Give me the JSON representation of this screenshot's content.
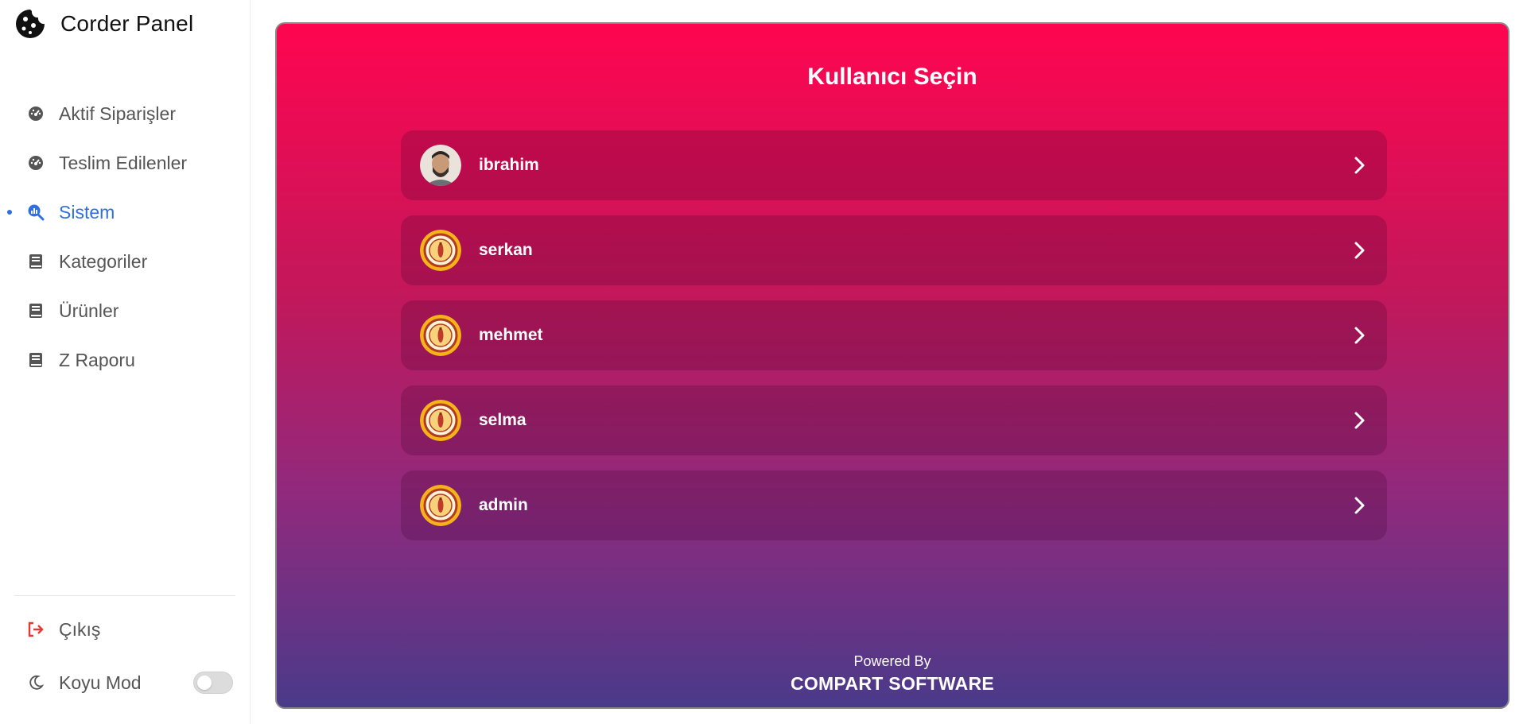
{
  "app": {
    "title": "Corder Panel"
  },
  "sidebar": {
    "items": [
      {
        "label": "Aktif Siparişler",
        "icon": "dashboard-gauge-icon"
      },
      {
        "label": "Teslim Edilenler",
        "icon": "dashboard-gauge-icon"
      },
      {
        "label": "Sistem",
        "icon": "search-chart-icon",
        "active": true
      },
      {
        "label": "Kategoriler",
        "icon": "book-icon"
      },
      {
        "label": "Ürünler",
        "icon": "book-icon"
      },
      {
        "label": "Z Raporu",
        "icon": "book-icon"
      }
    ],
    "logout": {
      "label": "Çıkış",
      "icon": "sign-out-icon"
    },
    "dark_mode": {
      "label": "Koyu Mod",
      "icon": "moon-icon",
      "enabled": false
    }
  },
  "main": {
    "title": "Kullanıcı Seçin",
    "users": [
      {
        "name": "ibrahim",
        "avatar": "photo-avatar"
      },
      {
        "name": "serkan",
        "avatar": "club-badge-avatar"
      },
      {
        "name": "mehmet",
        "avatar": "club-badge-avatar"
      },
      {
        "name": "selma",
        "avatar": "club-badge-avatar"
      },
      {
        "name": "admin",
        "avatar": "club-badge-avatar"
      }
    ],
    "footer": {
      "powered_by": "Powered By",
      "company": "COMPART SOFTWARE"
    }
  },
  "colors": {
    "accent": "#2f6fe0",
    "logout": "#e53935",
    "gradient_top": "#ff0550",
    "gradient_bottom": "#4a3a8a"
  }
}
